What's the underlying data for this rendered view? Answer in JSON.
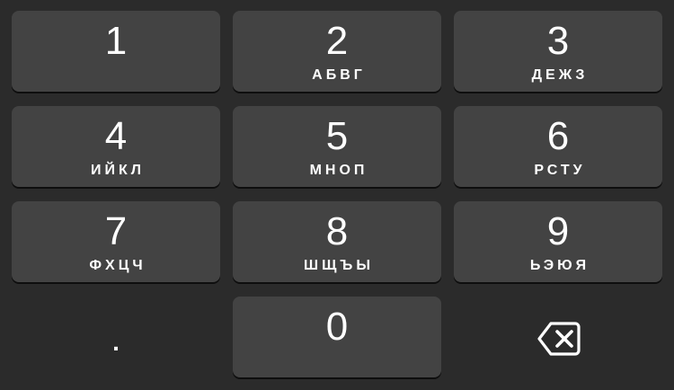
{
  "keypad": {
    "keys": [
      {
        "digit": "1",
        "letters": ""
      },
      {
        "digit": "2",
        "letters": "АБВГ"
      },
      {
        "digit": "3",
        "letters": "ДЕЖЗ"
      },
      {
        "digit": "4",
        "letters": "ИЙКЛ"
      },
      {
        "digit": "5",
        "letters": "МНОП"
      },
      {
        "digit": "6",
        "letters": "РСТУ"
      },
      {
        "digit": "7",
        "letters": "ФХЦЧ"
      },
      {
        "digit": "8",
        "letters": "ШЩЪЫ"
      },
      {
        "digit": "9",
        "letters": "ЬЭЮЯ"
      },
      {
        "digit": "0",
        "letters": ""
      }
    ],
    "decimal_symbol": ".",
    "delete_icon": "backspace-icon",
    "colors": {
      "background": "#2b2b2b",
      "key": "#434343",
      "key_shadow": "#0e0e0e",
      "text": "#ffffff"
    }
  }
}
